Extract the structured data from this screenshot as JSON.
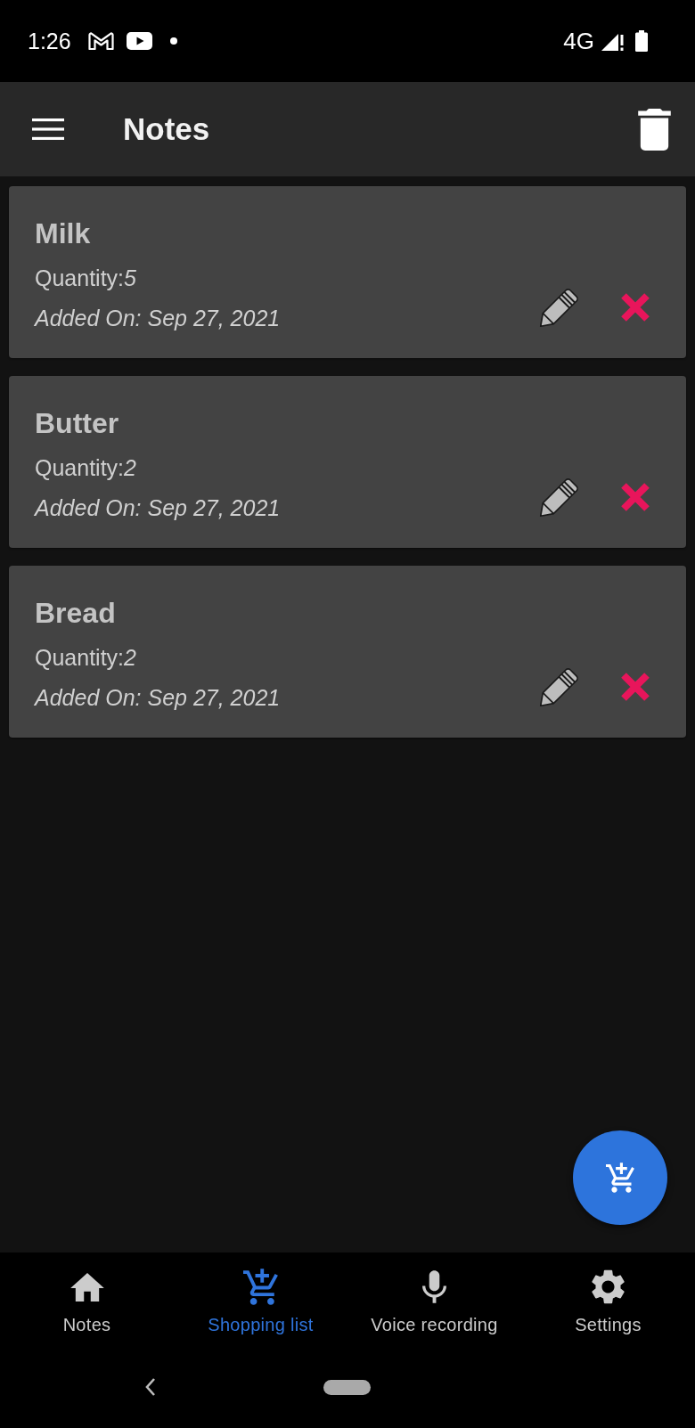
{
  "status_bar": {
    "time": "1:26",
    "network": "4G"
  },
  "app_bar": {
    "title": "Notes"
  },
  "notes": [
    {
      "title": "Milk",
      "quantity": "Quantity:*5*",
      "added_on": "Added On: Sep 27, 2021"
    },
    {
      "title": "Butter",
      "quantity": "Quantity:*2*",
      "added_on": "Added On: Sep 27, 2021"
    },
    {
      "title": "Bread",
      "quantity": "Quantity:*2*",
      "added_on": "Added On: Sep 27, 2021"
    }
  ],
  "bottom_nav": [
    {
      "label": "Notes",
      "selected": false
    },
    {
      "label": "Shopping list",
      "selected": true
    },
    {
      "label": "Voice recording",
      "selected": false
    },
    {
      "label": "Settings",
      "selected": false
    }
  ]
}
